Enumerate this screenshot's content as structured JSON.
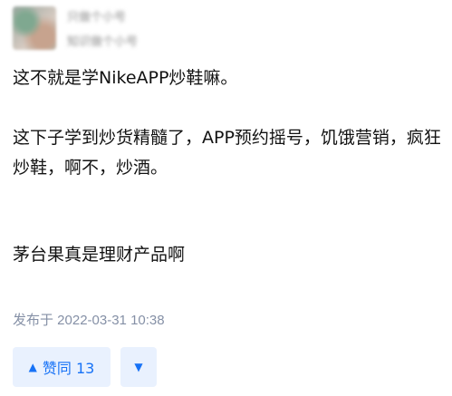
{
  "author": {
    "name": "只做个小号",
    "headline": "知识做个小号"
  },
  "content": {
    "paragraphs": [
      "这不就是学NikeAPP炒鞋嘛。",
      "这下子学到炒货精髓了，APP预约摇号，饥饿营销，疯狂炒鞋，啊不，炒酒。",
      "茅台果真是理财产品啊"
    ]
  },
  "meta": {
    "publish_time": "发布于 2022-03-31 10:38"
  },
  "actions": {
    "upvote_icon": "▲",
    "upvote_label": "赞同 13",
    "downvote_icon": "▼"
  },
  "colors": {
    "accent": "#1772f6",
    "accent_bg": "#e9f1fe",
    "meta_text": "#8590a6",
    "body_text": "#121212"
  }
}
